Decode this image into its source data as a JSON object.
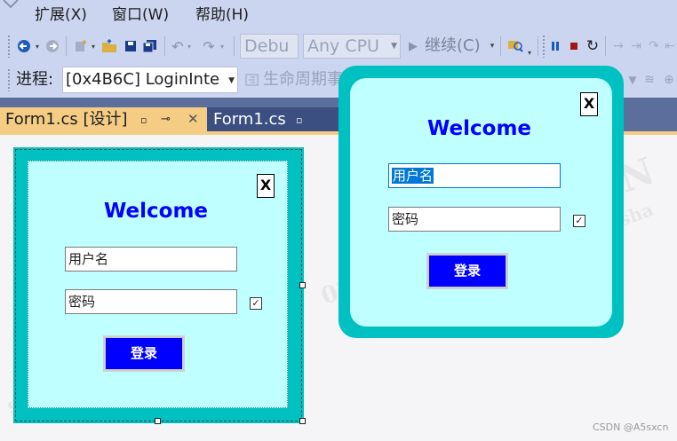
{
  "menu": {
    "extensions": "扩展(X)",
    "window": "窗口(W)",
    "help": "帮助(H)"
  },
  "toolbar": {
    "config_combo": "Debu",
    "platform_combo": "Any CPU",
    "continue_label": "继续(C)",
    "icons": [
      "back-icon",
      "forward-icon",
      "new-project-icon",
      "open-folder-icon",
      "save-icon",
      "save-all-icon",
      "undo-icon",
      "redo-icon",
      "continue-play-icon",
      "find-icon",
      "pause-icon",
      "stop-icon",
      "restart-icon",
      "step-icons"
    ]
  },
  "debug_location": {
    "process_label": "进程:",
    "process_value": "[0x4B6C] LoginInte",
    "lifecycle_label": "生命周期事"
  },
  "tabs": [
    {
      "label": "Form1.cs [设计]",
      "active": true
    },
    {
      "label": "Form1.cs",
      "active": false
    }
  ],
  "design_form": {
    "close_label": "X",
    "welcome": "Welcome",
    "username_placeholder": "用户名",
    "password_placeholder": "密码",
    "login_label": "登录",
    "show_password_checked": true
  },
  "running_form": {
    "close_label": "X",
    "welcome": "Welcome",
    "username_value": "用户名",
    "password_value": "密码",
    "login_label": "登录",
    "show_password_checked": true
  },
  "watermark": {
    "credit": "CSDN @A5sxcn"
  },
  "colors": {
    "form_border": "#00c1c1",
    "form_background": "#c0ffff",
    "welcome_text": "#0000ff",
    "login_button": "#0000ff",
    "active_tab": "#f5cc84",
    "tabstrip": "#5c6e9c",
    "menubar": "#ccd5f0"
  }
}
